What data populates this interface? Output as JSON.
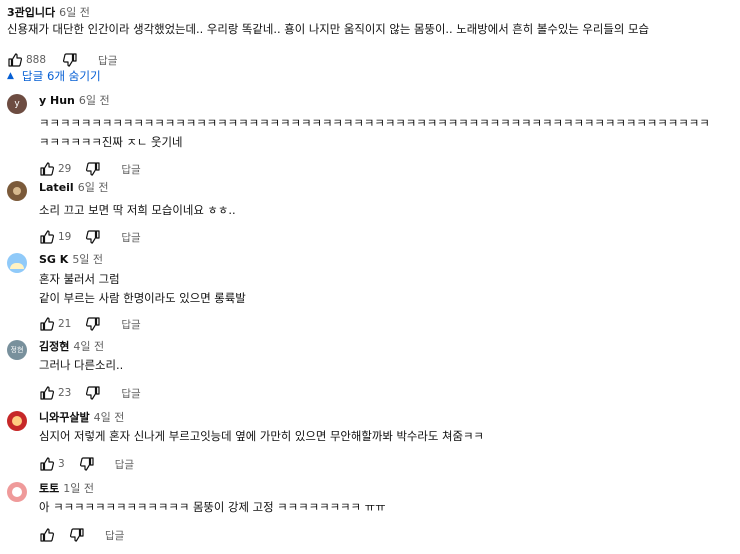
{
  "top_comment": {
    "author": "3관입니다",
    "time": "6일 전",
    "text": "신용재가 대단한 인간이라 생각했었는데.. 우리랑 똑같네.. 횽이 나지만 움직이지 않는 몸뚱이.. 노래방에서 흔히 볼수있는 우리들의 모습",
    "likes": "888",
    "reply_label": "답글"
  },
  "replies_toggle": {
    "label": "답글 6개 숨기기"
  },
  "colors": {
    "link": "#065fd4",
    "meta": "#606060",
    "text": "#0f0f0f"
  },
  "replies": [
    {
      "author": "y Hun",
      "time": "6일 전",
      "avatar_letter": "y",
      "avatar_color": "#6d4c41",
      "lines": [
        "ㅋㅋㅋㅋㅋㅋㅋㅋㅋㅋㅋㅋㅋㅋㅋㅋㅋㅋㅋㅋㅋㅋㅋㅋㅋㅋㅋㅋㅋㅋㅋㅋㅋㅋㅋㅋㅋㅋㅋㅋㅋㅋㅋㅋㅋㅋㅋㅋㅋㅋㅋㅋㅋㅋㅋㅋㅋㅋㅋㅋㅋㅋㅋㅋ",
        "ㅋㅋㅋㅋㅋㅋ진짜 ㅈㄴ 웃기네"
      ],
      "likes": "29",
      "reply_label": "답글"
    },
    {
      "author": "Lateil",
      "time": "6일 전",
      "avatar_letter": "",
      "avatar_color": "#7b5a3a",
      "lines": [
        "소리 끄고 보면 딱 저희 모습이네요 ㅎㅎ.."
      ],
      "likes": "19",
      "reply_label": "답글"
    },
    {
      "author": "SG K",
      "time": "5일 전",
      "avatar_letter": "",
      "avatar_color": "#90caf9",
      "lines": [
        "혼자 불러서 그럼",
        "같이 부르는 사람 한명이라도 있으면 롱륙발"
      ],
      "likes": "21",
      "reply_label": "답글"
    },
    {
      "author": "김정현",
      "time": "4일 전",
      "avatar_letter": "정현",
      "avatar_color": "#78909c",
      "lines": [
        "그러나 다른소리.."
      ],
      "likes": "23",
      "reply_label": "답글"
    },
    {
      "author": "니와꾸살발",
      "time": "4일 전",
      "avatar_letter": "",
      "avatar_color": "#c62828",
      "lines": [
        "심지어 저렇게 혼자 신나게 부르고잇능데 옆에 가만히 있으면 무안해할까봐 박수라도 쳐줌ㅋㅋ"
      ],
      "likes": "3",
      "reply_label": "답글"
    },
    {
      "author": "토토",
      "time": "1일 전",
      "avatar_letter": "",
      "avatar_color": "#ef9a9a",
      "lines": [
        "아 ㅋㅋㅋㅋㅋㅋㅋㅋㅋㅋㅋㅋㅋ 몸뚱이 강제 고정 ㅋㅋㅋㅋㅋㅋㅋㅋ ㅠㅠ"
      ],
      "likes": "",
      "reply_label": "답글"
    }
  ]
}
